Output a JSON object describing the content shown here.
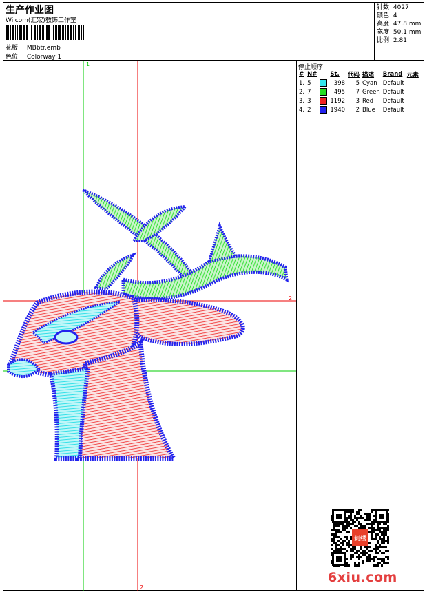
{
  "header": {
    "title": "生产作业图",
    "company": "Wilcom(汇宏)教饰工作室",
    "design_label": "花版:",
    "design_value": "MBbtr.emb",
    "colorway_label": "色位:",
    "colorway_value": "Colorway 1"
  },
  "stats": [
    {
      "label": "针数:",
      "value": "4027"
    },
    {
      "label": "颜色:",
      "value": "4"
    },
    {
      "label": "高度:",
      "value": "47.8 mm"
    },
    {
      "label": "宽度:",
      "value": "50.1 mm"
    },
    {
      "label": "比例:",
      "value": "2.81"
    }
  ],
  "stop_sequence": {
    "title": "停止顺序:",
    "headers": [
      "#",
      "N#",
      "St.",
      "代码",
      "描述",
      "Brand",
      "元素"
    ],
    "rows": [
      {
        "idx": "1.",
        "n": "5",
        "color": "#33e6ee",
        "st": "398",
        "code": "5",
        "desc": "Cyan",
        "brand": "Default"
      },
      {
        "idx": "2.",
        "n": "7",
        "color": "#22dd22",
        "st": "495",
        "code": "7",
        "desc": "Green",
        "brand": "Default"
      },
      {
        "idx": "3.",
        "n": "3",
        "color": "#ee2222",
        "st": "1192",
        "code": "3",
        "desc": "Red",
        "brand": "Default"
      },
      {
        "idx": "4.",
        "n": "2",
        "color": "#2222ee",
        "st": "1940",
        "code": "2",
        "desc": "Blue",
        "brand": "Default"
      }
    ]
  },
  "axes": {
    "v_green_label": "1",
    "h_red_label": "2",
    "v_red_label": "2"
  },
  "colors": {
    "blue": "#2222ee",
    "red": "#ee2222",
    "green": "#22dd22",
    "cyan": "#33e6ee",
    "guide_green": "#00cc00",
    "guide_red": "#ee0000",
    "brand": "#e43f3f"
  },
  "watermark": "6xiu.com",
  "qr_stamp": "刺绣"
}
